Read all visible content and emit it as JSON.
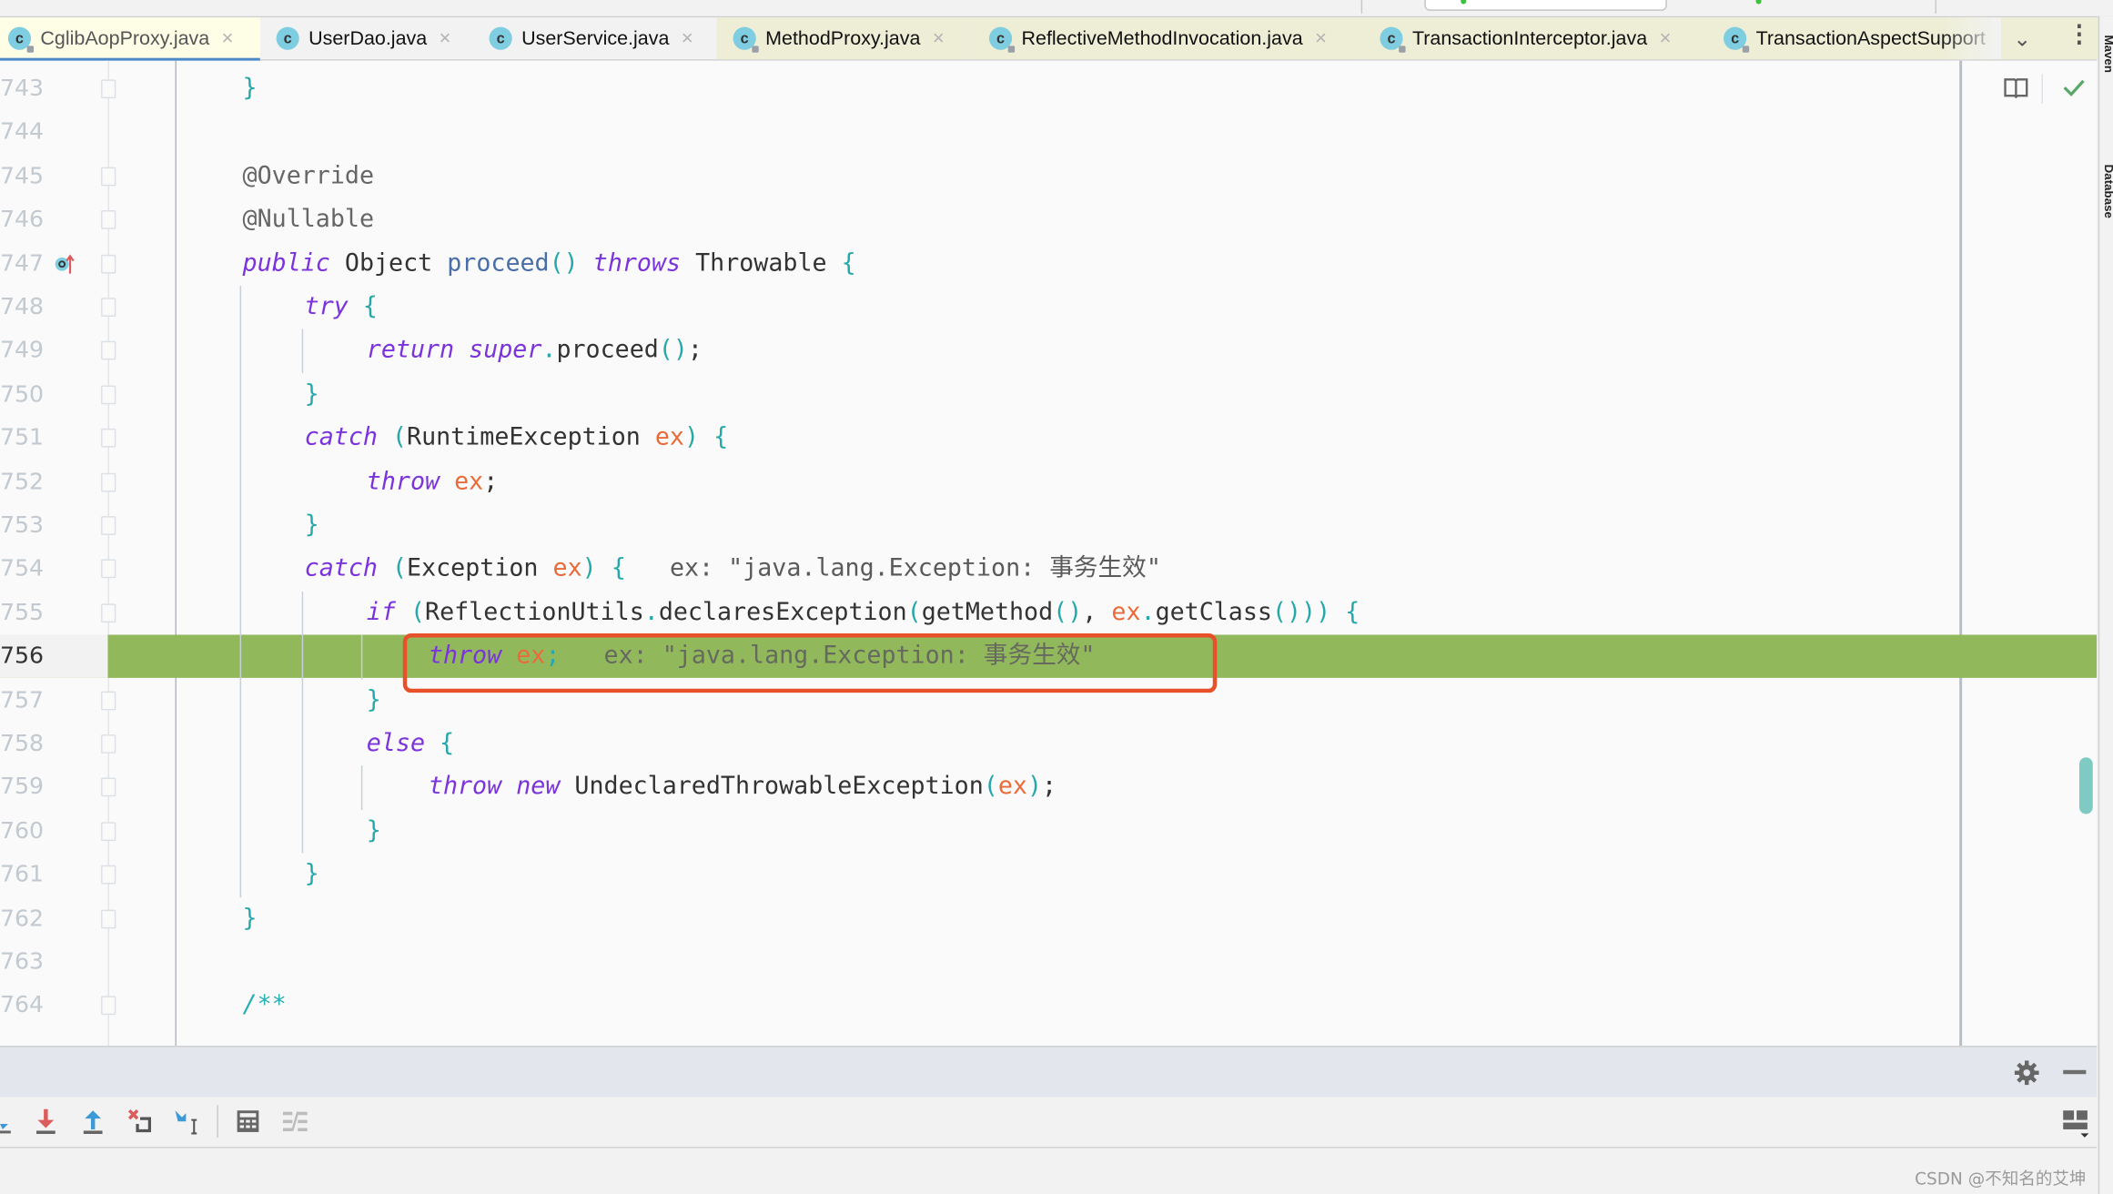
{
  "tabs": [
    {
      "label": "CglibAopProxy.java",
      "icon": "class-icon",
      "locked": true,
      "active": true,
      "closable": true,
      "style": "active"
    },
    {
      "label": "UserDao.java",
      "icon": "class-icon",
      "locked": false,
      "active": false,
      "closable": true,
      "style": "plain"
    },
    {
      "label": "UserService.java",
      "icon": "class-icon",
      "locked": false,
      "active": false,
      "closable": true,
      "style": "plain"
    },
    {
      "label": "MethodProxy.java",
      "icon": "class-icon",
      "locked": true,
      "active": false,
      "closable": true,
      "style": "yellow"
    },
    {
      "label": "ReflectiveMethodInvocation.java",
      "icon": "class-icon",
      "locked": true,
      "active": false,
      "closable": true,
      "style": "yellow"
    },
    {
      "label": "TransactionInterceptor.java",
      "icon": "class-icon",
      "locked": true,
      "active": false,
      "closable": true,
      "style": "yellow"
    },
    {
      "label": "TransactionAspectSupport",
      "icon": "class-icon",
      "locked": true,
      "active": false,
      "closable": false,
      "style": "yellow"
    }
  ],
  "tab_icon_letter": "c",
  "close_glyph": "×",
  "tab_overflow_glyph": "⌄",
  "tab_more_glyph": "⋮",
  "right_toolwindows": [
    "Maven",
    "Database"
  ],
  "editor": {
    "highlighted_line": 756,
    "lines": [
      {
        "n": "743",
        "tokens": [
          {
            "t": "}",
            "c": "br"
          }
        ],
        "indent": 0
      },
      {
        "n": "744",
        "tokens": [],
        "indent": 0
      },
      {
        "n": "745",
        "tokens": [
          {
            "t": "@Override",
            "c": "ann"
          }
        ],
        "indent": 0
      },
      {
        "n": "746",
        "tokens": [
          {
            "t": "@Nullable",
            "c": "ann"
          }
        ],
        "indent": 0
      },
      {
        "n": "747",
        "tokens": [
          {
            "t": "public",
            "c": "kw"
          },
          {
            "t": " Object ",
            "c": ""
          },
          {
            "t": "proceed",
            "c": "fn"
          },
          {
            "t": "()",
            "c": "br"
          },
          {
            "t": " ",
            "c": ""
          },
          {
            "t": "throws",
            "c": "kw"
          },
          {
            "t": " Throwable ",
            "c": ""
          },
          {
            "t": "{",
            "c": "br"
          }
        ],
        "indent": 0
      },
      {
        "n": "748",
        "tokens": [
          {
            "t": "try",
            "c": "kw"
          },
          {
            "t": " ",
            "c": ""
          },
          {
            "t": "{",
            "c": "br"
          }
        ],
        "indent": 1
      },
      {
        "n": "749",
        "tokens": [
          {
            "t": "return",
            "c": "kw"
          },
          {
            "t": " ",
            "c": ""
          },
          {
            "t": "super",
            "c": "kw"
          },
          {
            "t": ".",
            "c": "br"
          },
          {
            "t": "proceed",
            "c": ""
          },
          {
            "t": "()",
            "c": "br"
          },
          {
            "t": ";",
            "c": ""
          }
        ],
        "indent": 2
      },
      {
        "n": "750",
        "tokens": [
          {
            "t": "}",
            "c": "br"
          }
        ],
        "indent": 1
      },
      {
        "n": "751",
        "tokens": [
          {
            "t": "catch",
            "c": "kw"
          },
          {
            "t": " ",
            "c": ""
          },
          {
            "t": "(",
            "c": "br"
          },
          {
            "t": "RuntimeException ",
            "c": ""
          },
          {
            "t": "ex",
            "c": "var"
          },
          {
            "t": ")",
            "c": "br"
          },
          {
            "t": " ",
            "c": ""
          },
          {
            "t": "{",
            "c": "br"
          }
        ],
        "indent": 1
      },
      {
        "n": "752",
        "tokens": [
          {
            "t": "throw",
            "c": "kw"
          },
          {
            "t": " ",
            "c": ""
          },
          {
            "t": "ex",
            "c": "var"
          },
          {
            "t": ";",
            "c": ""
          }
        ],
        "indent": 2
      },
      {
        "n": "753",
        "tokens": [
          {
            "t": "}",
            "c": "br"
          }
        ],
        "indent": 1
      },
      {
        "n": "754",
        "tokens": [
          {
            "t": "catch",
            "c": "kw"
          },
          {
            "t": " ",
            "c": ""
          },
          {
            "t": "(",
            "c": "br"
          },
          {
            "t": "Exception ",
            "c": ""
          },
          {
            "t": "ex",
            "c": "var"
          },
          {
            "t": ")",
            "c": "br"
          },
          {
            "t": " ",
            "c": ""
          },
          {
            "t": "{",
            "c": "br"
          },
          {
            "t": "   ex: \"java.lang.Exception: 事务生效\"",
            "c": "inl"
          }
        ],
        "indent": 1
      },
      {
        "n": "755",
        "tokens": [
          {
            "t": "if",
            "c": "kw"
          },
          {
            "t": " ",
            "c": ""
          },
          {
            "t": "(",
            "c": "br"
          },
          {
            "t": "ReflectionUtils",
            "c": ""
          },
          {
            "t": ".",
            "c": "br"
          },
          {
            "t": "declaresException",
            "c": ""
          },
          {
            "t": "(",
            "c": "br"
          },
          {
            "t": "getMethod",
            "c": ""
          },
          {
            "t": "()",
            "c": "br"
          },
          {
            "t": ", ",
            "c": ""
          },
          {
            "t": "ex",
            "c": "var"
          },
          {
            "t": ".",
            "c": "br"
          },
          {
            "t": "getClass",
            "c": ""
          },
          {
            "t": "()))",
            "c": "br"
          },
          {
            "t": " ",
            "c": ""
          },
          {
            "t": "{",
            "c": "br"
          }
        ],
        "indent": 2
      },
      {
        "n": "756",
        "tokens": [
          {
            "t": "throw",
            "c": "kw"
          },
          {
            "t": " ",
            "c": ""
          },
          {
            "t": "ex",
            "c": "var"
          },
          {
            "t": ";",
            "c": "br"
          },
          {
            "t": "   ex: \"java.lang.Exception: 事务生效\"",
            "c": "inl"
          }
        ],
        "indent": 3
      },
      {
        "n": "757",
        "tokens": [
          {
            "t": "}",
            "c": "br"
          }
        ],
        "indent": 2
      },
      {
        "n": "758",
        "tokens": [
          {
            "t": "else",
            "c": "kw"
          },
          {
            "t": " ",
            "c": ""
          },
          {
            "t": "{",
            "c": "br"
          }
        ],
        "indent": 2
      },
      {
        "n": "759",
        "tokens": [
          {
            "t": "throw",
            "c": "kw"
          },
          {
            "t": " ",
            "c": ""
          },
          {
            "t": "new",
            "c": "kw"
          },
          {
            "t": " UndeclaredThrowableException",
            "c": ""
          },
          {
            "t": "(",
            "c": "br"
          },
          {
            "t": "ex",
            "c": "var"
          },
          {
            "t": ")",
            "c": "br"
          },
          {
            "t": ";",
            "c": ""
          }
        ],
        "indent": 3
      },
      {
        "n": "760",
        "tokens": [
          {
            "t": "}",
            "c": "br"
          }
        ],
        "indent": 2
      },
      {
        "n": "761",
        "tokens": [
          {
            "t": "}",
            "c": "br"
          }
        ],
        "indent": 1
      },
      {
        "n": "762",
        "tokens": [
          {
            "t": "}",
            "c": "br"
          }
        ],
        "indent": 0
      },
      {
        "n": "763",
        "tokens": [],
        "indent": 0
      },
      {
        "n": "764",
        "tokens": [
          {
            "t": "/**",
            "c": "cmt"
          }
        ],
        "indent": 0
      }
    ]
  },
  "colors": {
    "execution_line": "#92b85c",
    "annotation_box": "#e8502a",
    "active_tab_underline": "#4a88c7"
  },
  "watermark": "CSDN @不知名的艾坤"
}
